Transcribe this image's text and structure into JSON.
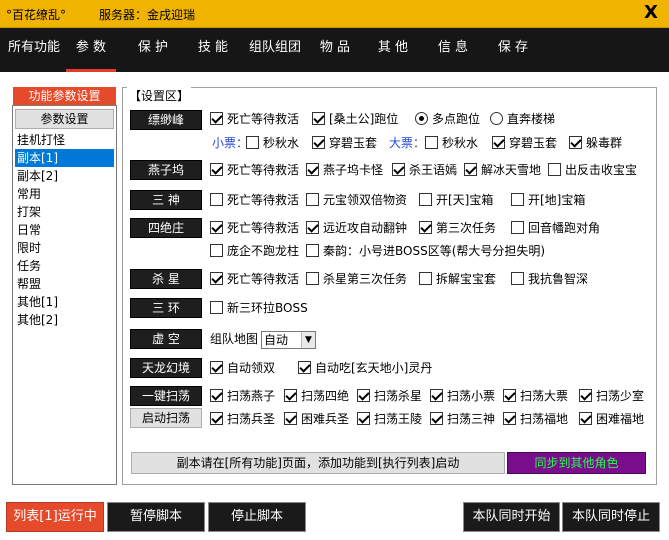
{
  "titlebar": {
    "app_title": "°百花缭乱°",
    "server": "服务器：金戌迎瑞",
    "close": "X"
  },
  "menu": [
    {
      "label": "所有功能"
    },
    {
      "label": "参 数"
    },
    {
      "label": "保 护"
    },
    {
      "label": "技 能"
    },
    {
      "label": "组队组团"
    },
    {
      "label": "物 品"
    },
    {
      "label": "其 他"
    },
    {
      "label": "信 息"
    },
    {
      "label": "保 存"
    }
  ],
  "sidebar": {
    "header": "功能参数设置",
    "param_button": "参数设置",
    "items": [
      "挂机打怪",
      "副本[1]",
      "副本[2]",
      "常用",
      "打架",
      "日常",
      "限时",
      "任务",
      "帮盟",
      "其他[1]",
      "其他[2]"
    ]
  },
  "panel": {
    "title": "【设置区】",
    "rows": {
      "r1": {
        "label": "缥缈峰",
        "opts": [
          "死亡等待救活",
          "[桑土公]跑位",
          "多点跑位",
          "直奔楼梯"
        ],
        "small_label": "小票：",
        "big_label": "大票：",
        "small": [
          "秒秋水",
          "穿碧玉套"
        ],
        "big": [
          "秒秋水",
          "穿碧玉套",
          "躲毒群"
        ]
      },
      "r2": {
        "label": "燕子坞",
        "opts": [
          "死亡等待救活",
          "燕子坞卡怪",
          "杀王语嫣",
          "解冰天雪地",
          "出反击收宝宝"
        ]
      },
      "r3": {
        "label": "三 神",
        "opts": [
          "死亡等待救活",
          "元宝领双倍物资",
          "开[天]宝箱",
          "开[地]宝箱"
        ]
      },
      "r4": {
        "label": "四绝庄",
        "opts": [
          "死亡等待救活",
          "远近攻自动翻钟",
          "第三次任务",
          "回音幡跑对角"
        ],
        "opts2": [
          "庞企不跑龙柱",
          "秦韵：小号进BOSS区等(帮大号分担失明)"
        ]
      },
      "r5": {
        "label": "杀 星",
        "opts": [
          "死亡等待救活",
          "杀星第三次任务",
          "拆解宝宝套",
          "我抗鲁智深"
        ]
      },
      "r6": {
        "label": "三 环",
        "opts": [
          "新三环拉BOSS"
        ]
      },
      "r7": {
        "label": "虚 空",
        "map_label": "组队地图",
        "map_value": "自动"
      },
      "r8": {
        "label": "天龙幻境",
        "opts": [
          "自动领双",
          "自动吃[玄天地小]灵丹"
        ]
      },
      "r9": {
        "label": "一键扫荡",
        "start_button": "启动扫荡",
        "opts": [
          "扫荡燕子",
          "扫荡四绝",
          "扫荡杀星",
          "扫荡小票",
          "扫荡大票",
          "扫荡少室"
        ],
        "opts2": [
          "扫荡兵圣",
          "困难兵圣",
          "扫荡王陵",
          "扫荡三神",
          "扫荡福地",
          "困难福地"
        ]
      }
    },
    "note_button": "副本请在[所有功能]页面，添加功能到[执行列表]启动",
    "sync_button": "同步到其他角色"
  },
  "bottom": {
    "run": "列表[1]运行中",
    "pause": "暂停脚本",
    "stop": "停止脚本",
    "team_start": "本队同时开始",
    "team_stop": "本队同时停止"
  },
  "colors": {
    "titlebar": "#f0b400",
    "menubar": "#161616",
    "accent": "#e54a2a",
    "sync_bg": "#7a0d8c",
    "sync_fg": "#22ff4a",
    "link_blue": "#2a49d8"
  }
}
